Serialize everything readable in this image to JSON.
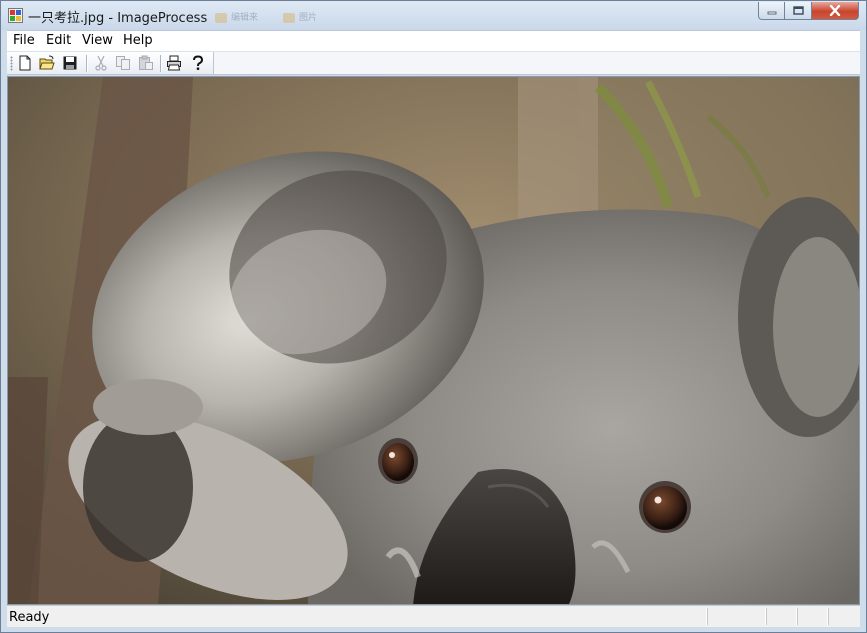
{
  "window": {
    "title": "一只考拉.jpg - ImageProcess",
    "ghost_tabs": [
      "编辑来",
      "图片"
    ]
  },
  "menu": [
    {
      "label": "File"
    },
    {
      "label": "Edit"
    },
    {
      "label": "View"
    },
    {
      "label": "Help"
    }
  ],
  "toolbar": {
    "buttons": [
      {
        "name": "new-icon",
        "enabled": true
      },
      {
        "name": "open-icon",
        "enabled": true
      },
      {
        "name": "save-icon",
        "enabled": true
      },
      {
        "name": "cut-icon",
        "enabled": false
      },
      {
        "name": "copy-icon",
        "enabled": false
      },
      {
        "name": "paste-icon",
        "enabled": false
      },
      {
        "name": "print-icon",
        "enabled": true
      },
      {
        "name": "help-icon",
        "enabled": true
      }
    ]
  },
  "status": {
    "text": "Ready"
  },
  "colors": {
    "titlebar": "#c9d8ea",
    "close_button": "#c8452f",
    "koala_fur": "#8e8b86",
    "koala_nose": "#2a2624",
    "background_bokeh": "#7a6a52"
  }
}
